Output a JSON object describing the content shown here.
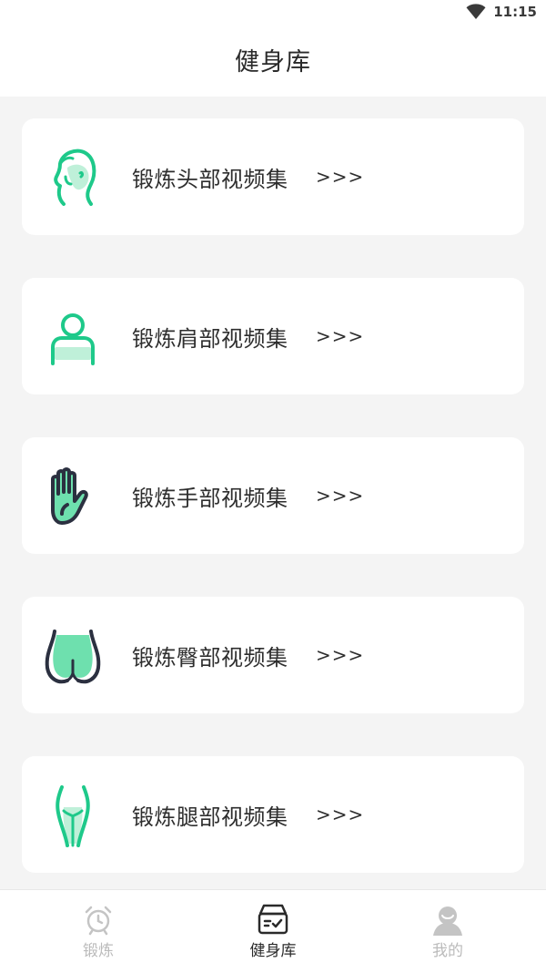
{
  "status_bar": {
    "time": "11:15",
    "wifi_icon": "wifi-icon"
  },
  "header": {
    "title": "健身库"
  },
  "cards": [
    {
      "label": "锻炼头部视频集",
      "arrow": ">>>",
      "icon": "head-icon"
    },
    {
      "label": "锻炼肩部视频集",
      "arrow": ">>>",
      "icon": "shoulder-icon"
    },
    {
      "label": "锻炼手部视频集",
      "arrow": ">>>",
      "icon": "hand-icon"
    },
    {
      "label": "锻炼臀部视频集",
      "arrow": ">>>",
      "icon": "hip-icon"
    },
    {
      "label": "锻炼腿部视频集",
      "arrow": ">>>",
      "icon": "leg-icon"
    }
  ],
  "tab_bar": {
    "tabs": [
      {
        "label": "锻炼",
        "icon": "alarm-clock-icon",
        "active": false
      },
      {
        "label": "健身库",
        "icon": "archive-box-icon",
        "active": true
      },
      {
        "label": "我的",
        "icon": "user-avatar-icon",
        "active": false
      }
    ]
  },
  "colors": {
    "accent_green": "#1ec98a",
    "light_green": "#6ee0ae",
    "dark_navy": "#2b3040",
    "background": "#f4f4f4",
    "card": "#ffffff",
    "inactive_gray": "#bbbbbb"
  }
}
